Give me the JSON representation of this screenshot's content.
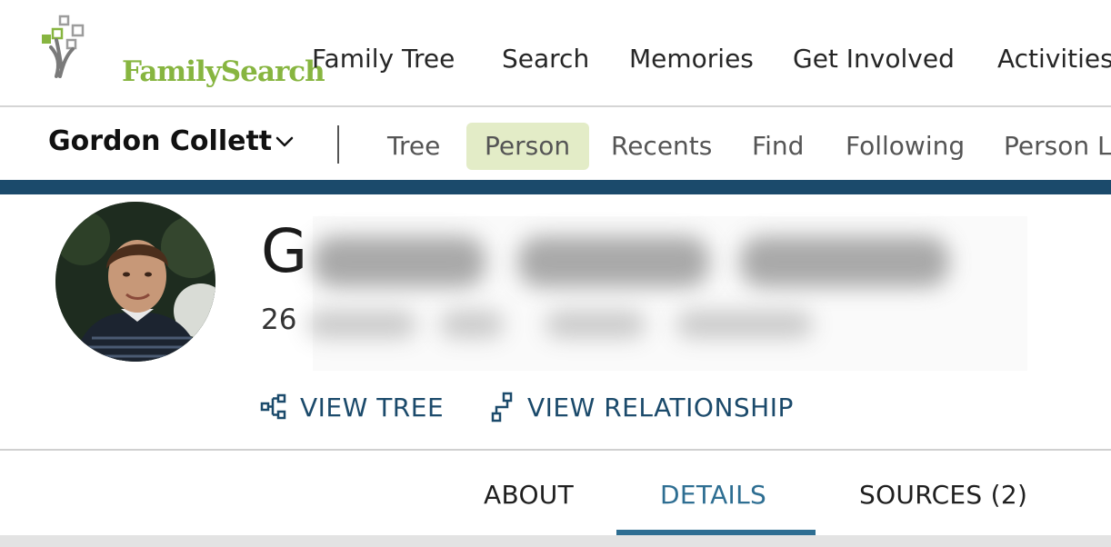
{
  "brand": {
    "name": "FamilySearch",
    "color": "#87b540"
  },
  "top_nav": {
    "items": [
      "Family Tree",
      "Search",
      "Memories",
      "Get Involved",
      "Activities"
    ]
  },
  "sub_nav": {
    "user_name": "Gordon Collett",
    "items": [
      "Tree",
      "Person",
      "Recents",
      "Find",
      "Following",
      "Person L"
    ],
    "active": "Person"
  },
  "person": {
    "name_visible": "G",
    "vitals_visible": "26"
  },
  "actions": {
    "view_tree": "VIEW TREE",
    "view_relationship": "VIEW RELATIONSHIP"
  },
  "tabs": {
    "items": [
      "ABOUT",
      "DETAILS",
      "SOURCES (2)"
    ],
    "active": "DETAILS"
  },
  "colors": {
    "accent_blue": "#1b4a6b",
    "tab_active": "#2e6e92",
    "active_subnav_bg": "#e3ecc7"
  }
}
